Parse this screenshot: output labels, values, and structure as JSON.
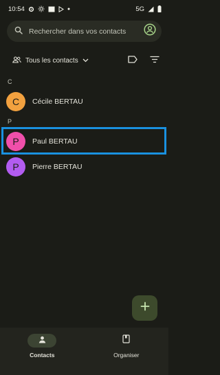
{
  "status_bar": {
    "time": "10:54",
    "network": "5G",
    "left_icons": [
      "gear-icon",
      "brightness-icon",
      "image-icon",
      "play-store-icon",
      "dot-icon"
    ],
    "right_icons": [
      "signal-icon",
      "battery-icon"
    ]
  },
  "search": {
    "placeholder": "Rechercher dans vos contacts",
    "icon": "search-icon",
    "account_icon": "account-circle-icon"
  },
  "filter": {
    "label": "Tous les contacts",
    "icons": [
      "people-icon",
      "chevron-down-icon",
      "label-icon",
      "sort-icon"
    ]
  },
  "sections": [
    {
      "letter": "C",
      "contacts": [
        {
          "initial": "C",
          "name": "Cécile BERTAU",
          "avatar_color": "#f2a13f"
        }
      ]
    },
    {
      "letter": "P",
      "contacts": [
        {
          "initial": "P",
          "name": "Paul BERTAU",
          "avatar_color": "#f04faa",
          "highlighted": true
        },
        {
          "initial": "P",
          "name": "Pierre BERTAU",
          "avatar_color": "#b25cf0"
        }
      ]
    }
  ],
  "fab": {
    "icon": "plus-icon",
    "color": "#3d4a2c"
  },
  "bottom_nav": {
    "items": [
      {
        "label": "Contacts",
        "icon": "person-icon",
        "active": true
      },
      {
        "label": "Organiser",
        "icon": "bookmark-icon",
        "active": false
      }
    ]
  },
  "colors": {
    "background": "#1b1c17",
    "highlight": "#1a91e0",
    "text": "#e4e3da"
  }
}
